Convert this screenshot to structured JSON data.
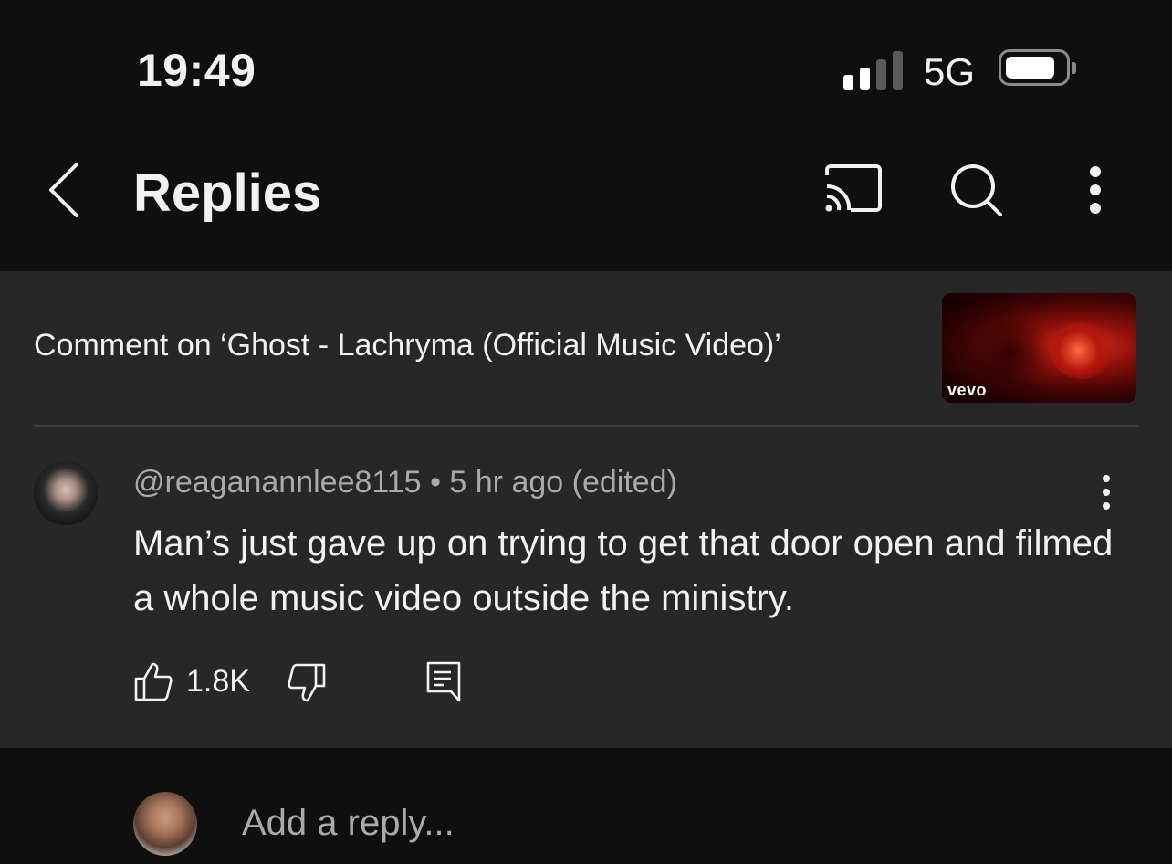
{
  "status_bar": {
    "time": "19:49",
    "network": "5G",
    "signal_bars": 2,
    "signal_bars_total": 4
  },
  "header": {
    "title": "Replies",
    "icons": [
      "back-icon",
      "cast-icon",
      "search-icon",
      "more-vert-icon"
    ]
  },
  "context": {
    "label": "Comment on ‘Ghost - Lachryma (Official Music Video)’",
    "thumbnail_badge": "vevo"
  },
  "comment": {
    "handle": "@reaganannlee8115",
    "separator": "•",
    "time": "5 hr ago (edited)",
    "text": "Man’s just gave up on trying to get that door open and filmed a whole music video outside the ministry.",
    "like_count": "1.8K"
  },
  "reply": {
    "placeholder": "Add a reply..."
  },
  "colors": {
    "background": "#0f0f0f",
    "panel": "#272727",
    "text": "#f1f1f1",
    "secondary_text": "#aaaaaa"
  }
}
